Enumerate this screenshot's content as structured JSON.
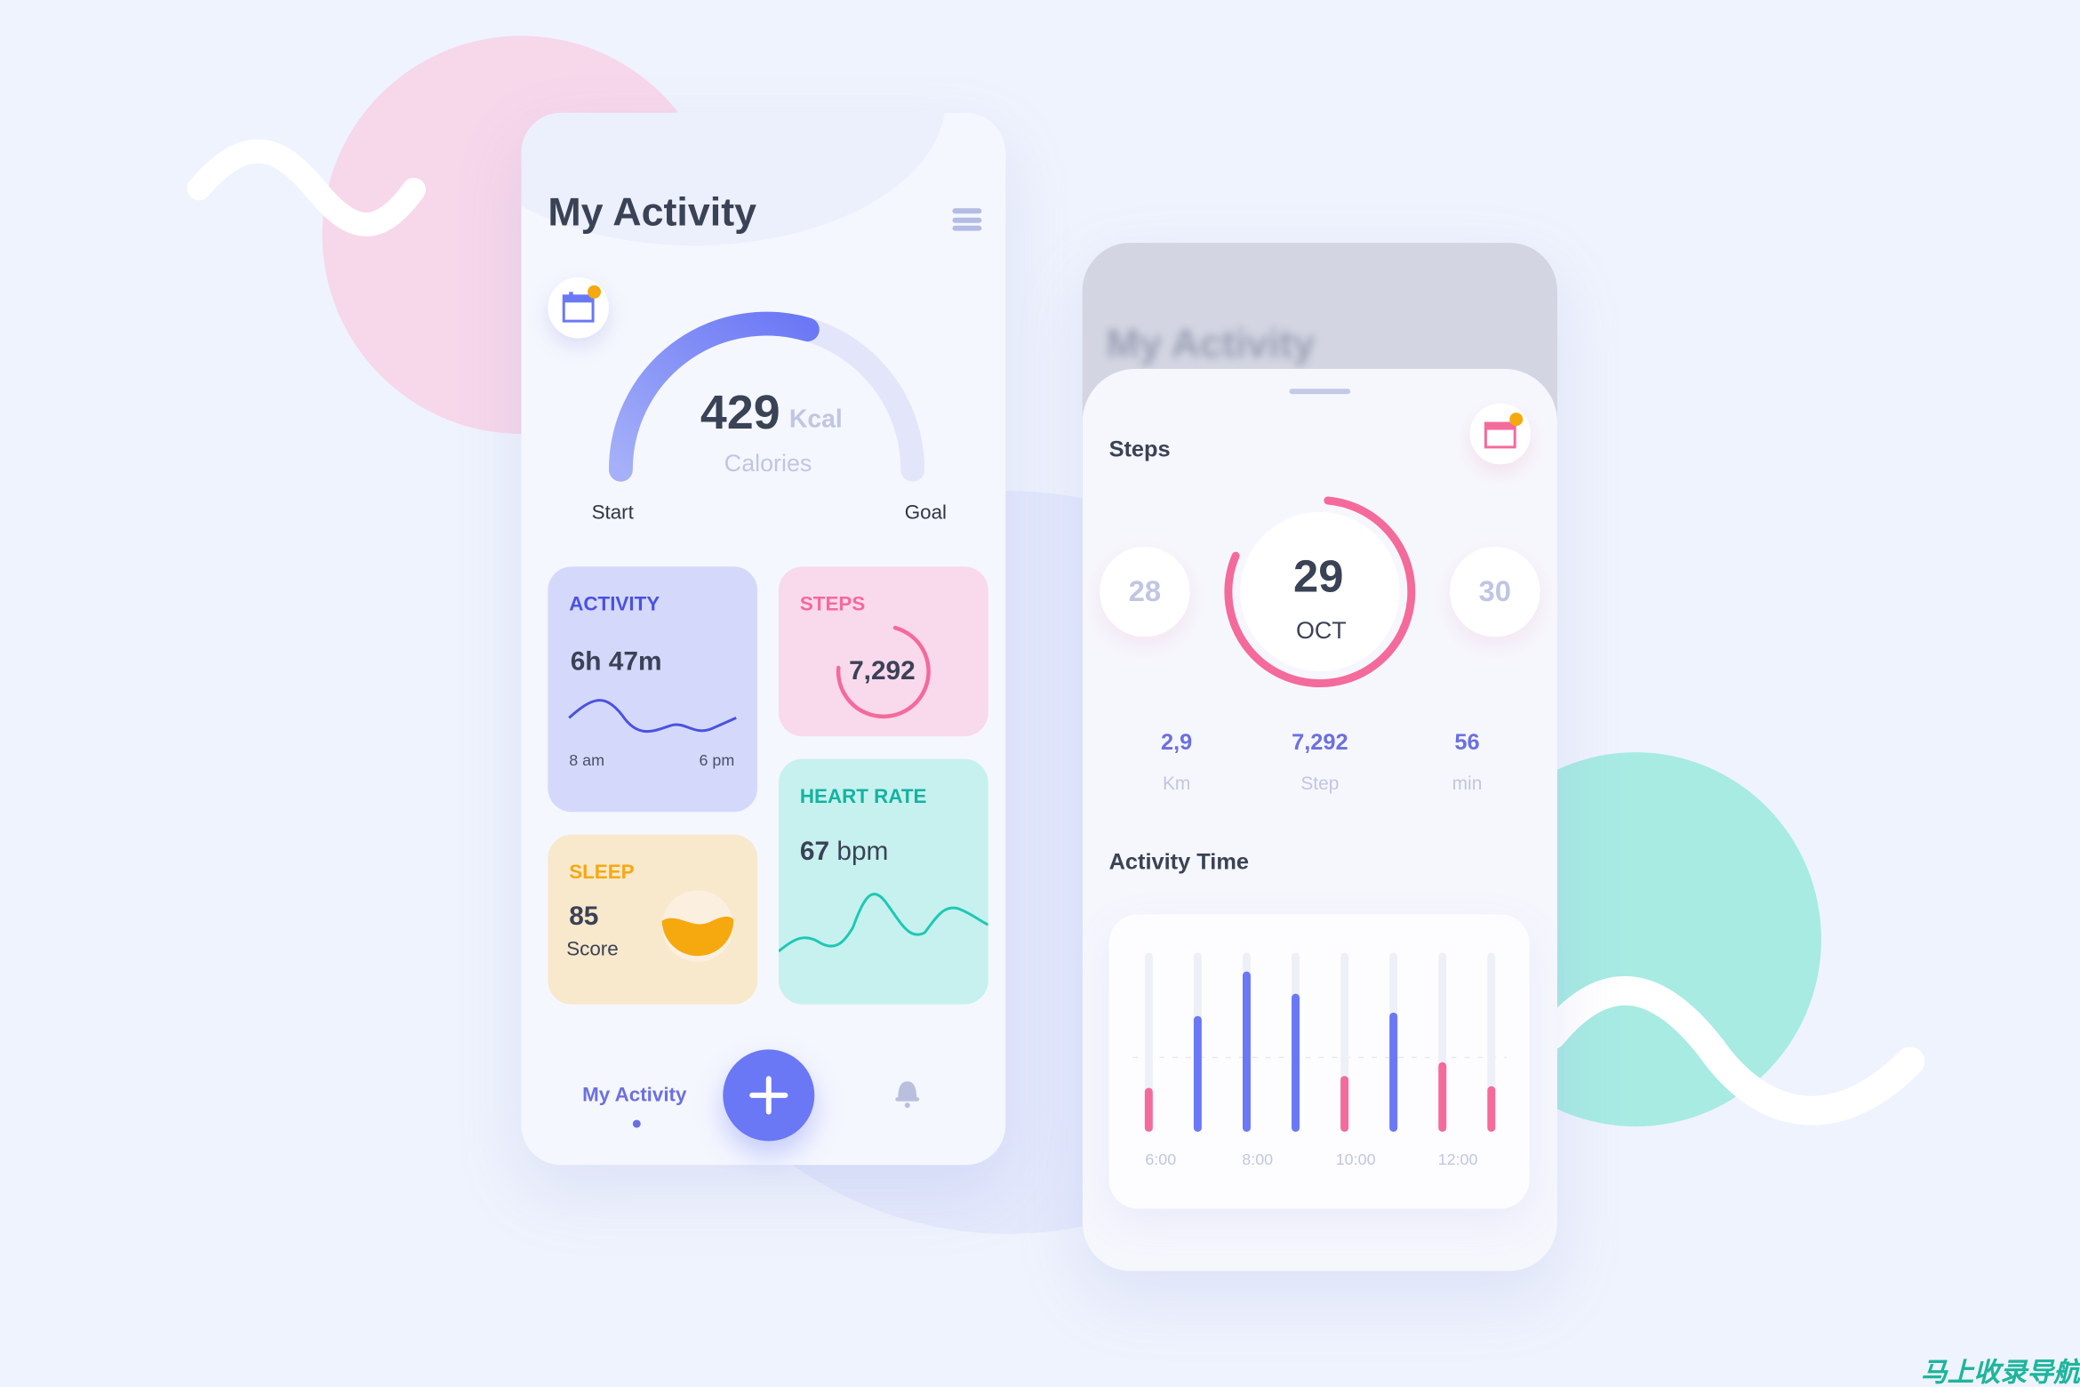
{
  "colors": {
    "accent": "#6b78f5",
    "pink": "#f46a9b",
    "teal": "#1ec8b4",
    "amber": "#f5a90f",
    "text": "#3a4256",
    "muted": "#b9bfdc"
  },
  "left_phone": {
    "title": "My Activity",
    "menu_icon": "hamburger-icon",
    "calendar_icon": "calendar-icon",
    "calories": {
      "value": "429",
      "unit": "Kcal",
      "label": "Calories",
      "start_label": "Start",
      "goal_label": "Goal",
      "progress": 0.59
    },
    "cards": {
      "activity": {
        "title": "ACTIVITY",
        "value": "6h 47m",
        "from": "8 am",
        "to": "6 pm"
      },
      "steps": {
        "title": "STEPS",
        "value": "7,292",
        "progress": 0.72
      },
      "sleep": {
        "title": "SLEEP",
        "value": "85",
        "label": "Score"
      },
      "heart": {
        "title": "HEART RATE",
        "value": "67",
        "unit": "bpm"
      }
    },
    "nav": {
      "active_label": "My Activity",
      "add_icon": "plus-icon",
      "bell_icon": "bell-icon"
    }
  },
  "right_phone": {
    "blurred_title": "My Activity",
    "steps_title": "Steps",
    "dates": {
      "prev": "28",
      "current_day": "29",
      "current_month": "OCT",
      "next": "30",
      "progress": 0.8
    },
    "stats": [
      {
        "value": "2,9",
        "unit": "Km"
      },
      {
        "value": "7,292",
        "unit": "Step"
      },
      {
        "value": "56",
        "unit": "min"
      }
    ],
    "activity_title": "Activity Time",
    "chart_data": {
      "type": "bar",
      "x_tick_labels": [
        "6:00",
        "8:00",
        "10:00",
        "12:00"
      ],
      "values": [
        0.21,
        0.63,
        0.89,
        0.76,
        0.28,
        0.65,
        0.36,
        0.22
      ],
      "highlight": [
        "pink",
        "blue",
        "blue",
        "blue",
        "pink",
        "blue",
        "pink",
        "pink"
      ],
      "ylim": [
        0,
        1
      ],
      "grid": "dashed midline"
    }
  },
  "watermark": "马上收录导航"
}
